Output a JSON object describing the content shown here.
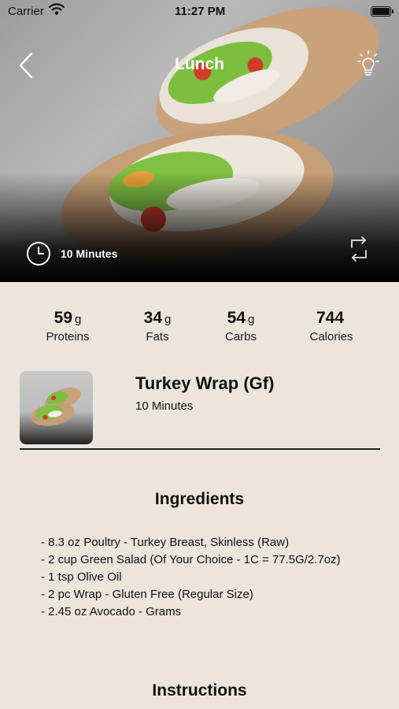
{
  "status_bar": {
    "carrier": "Carrier",
    "time": "11:27 PM"
  },
  "header": {
    "title": "Lunch"
  },
  "hero": {
    "time_label": "10 Minutes"
  },
  "macros": [
    {
      "value": "59",
      "unit": "g",
      "label": "Proteins"
    },
    {
      "value": "34",
      "unit": "g",
      "label": "Fats"
    },
    {
      "value": "54",
      "unit": "g",
      "label": "Carbs"
    },
    {
      "value": "744",
      "unit": "",
      "label": "Calories"
    }
  ],
  "recipe": {
    "name": "Turkey Wrap (Gf)",
    "time": "10 Minutes"
  },
  "ingredients": {
    "title": "Ingredients",
    "items": [
      "- 8.3 oz Poultry - Turkey Breast, Skinless (Raw)",
      "- 2 cup Green Salad (Of Your Choice - 1C = 77.5G/2.7oz)",
      "- 1 tsp Olive Oil",
      "- 2 pc Wrap - Gluten Free (Regular Size)",
      "- 2.45 oz Avocado - Grams"
    ]
  },
  "instructions": {
    "title": "Instructions"
  }
}
